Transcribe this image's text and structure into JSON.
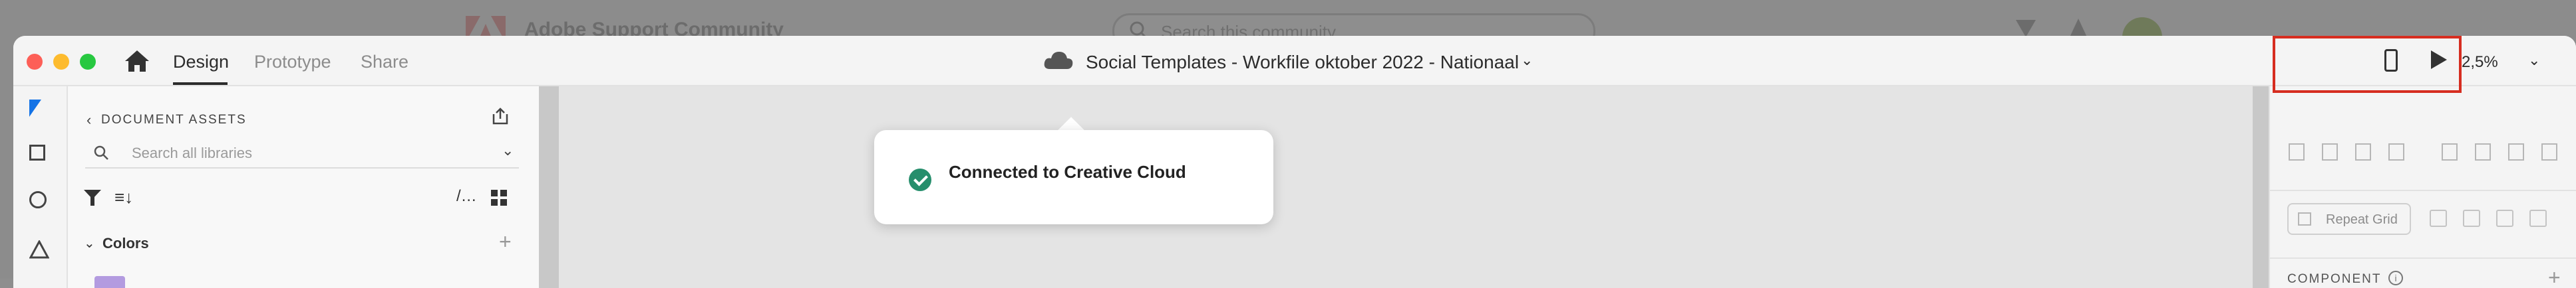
{
  "background_page": {
    "title": "Adobe Support Community",
    "search_placeholder": "Search this community"
  },
  "titlebar": {
    "tabs": [
      "Design",
      "Prototype",
      "Share"
    ],
    "document_title": "Social Templates - Workfile oktober 2022 - Nationaal",
    "zoom": "2,5%"
  },
  "assets": {
    "title": "DOCUMENT ASSETS",
    "search_placeholder": "Search all libraries",
    "colors_label": "Colors"
  },
  "toast": {
    "message": "Connected to Creative Cloud"
  },
  "properties": {
    "repeat_grid_label": "Repeat Grid",
    "component_label": "COMPONENT"
  },
  "colors": {
    "accent": "#1473e6",
    "highlight": "#d62d20",
    "success": "#268e6c"
  }
}
